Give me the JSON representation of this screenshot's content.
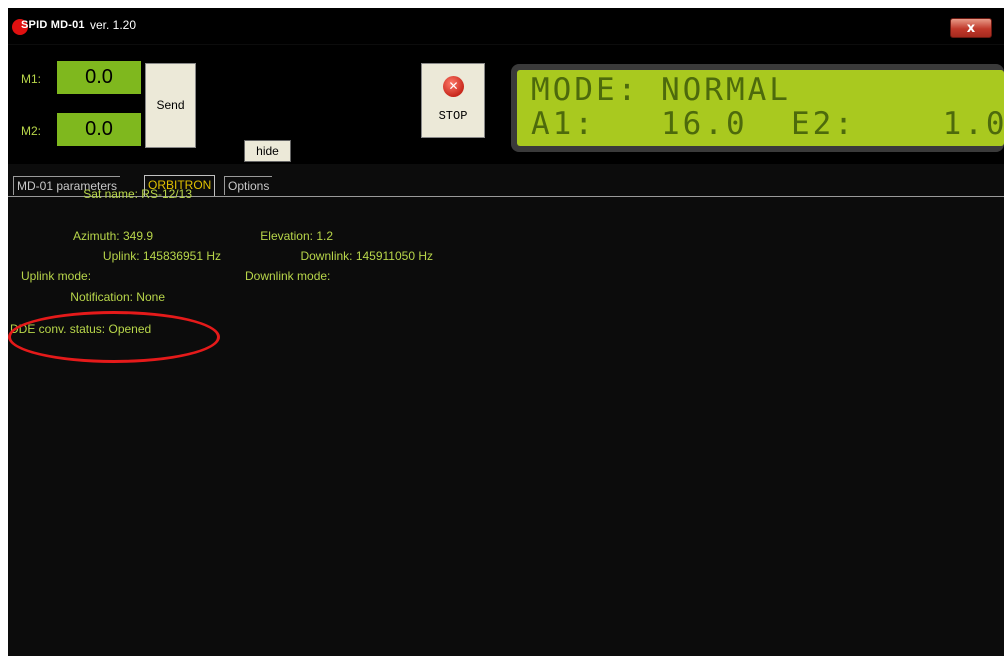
{
  "titlebar": {
    "brand": "SPID MD-01",
    "version": "ver. 1.20",
    "close_label": "x"
  },
  "controls": {
    "m1_label": "M1:",
    "m1_value": "0.0",
    "m2_label": "M2:",
    "m2_value": "0.0",
    "send_label": "Send",
    "hide_label": "hide",
    "stop_label": "STOP"
  },
  "lcd": {
    "line1": "MODE: NORMAL",
    "line2": "A1:   16.0  E2:    1.0"
  },
  "tabs": [
    {
      "label": "MD-01 parameters",
      "active": false
    },
    {
      "label": "ORBITRON",
      "active": true
    },
    {
      "label": "Options",
      "active": false
    }
  ],
  "orbitron": {
    "sat_name": "Sat name: RS-12/13",
    "azimuth": "Azimuth: 349.9",
    "elevation": "Elevation: 1.2",
    "uplink": "Uplink: 145836951 Hz",
    "downlink": "Downlink: 145911050 Hz",
    "uplink_mode": "Uplink mode:",
    "downlink_mode": "Downlink mode:",
    "notification": "Notification: None",
    "dde_status": "DDE conv. status: Opened"
  },
  "colors": {
    "background": "#0c0c0c",
    "info_text": "#b8d64a",
    "lcd_background": "#a9c91f",
    "active_tab_text": "#e0c000",
    "highlight_circle": "#e51a1a"
  },
  "icons": {
    "logo": "red-circle-logo",
    "close": "close-icon",
    "stop": "stop-x-icon"
  }
}
